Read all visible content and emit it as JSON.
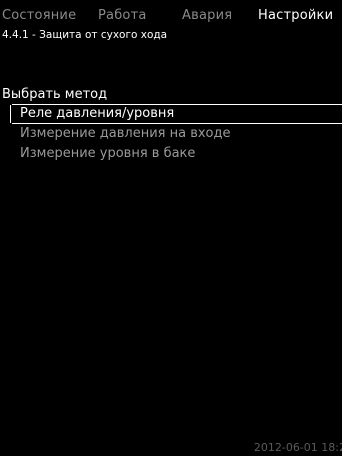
{
  "tabs": [
    {
      "label": "Состояние",
      "active": false
    },
    {
      "label": "Работа",
      "active": false
    },
    {
      "label": "Авария",
      "active": false
    },
    {
      "label": "Настройки",
      "active": true
    }
  ],
  "subtitle": "4.4.1 - Защита от сухого хода",
  "section_label": "Выбрать метод",
  "options": [
    {
      "label": "Реле давления/уровня",
      "selected": true
    },
    {
      "label": "Измерение давления на входе",
      "selected": false
    },
    {
      "label": "Измерение уровня в баке",
      "selected": false
    }
  ],
  "footer": {
    "timestamp": "2012-06-01 18:2"
  },
  "colors": {
    "background": "#000000",
    "active_text": "#ffffff",
    "inactive_text": "#8a8a8a",
    "timestamp": "#5a5a5a"
  }
}
